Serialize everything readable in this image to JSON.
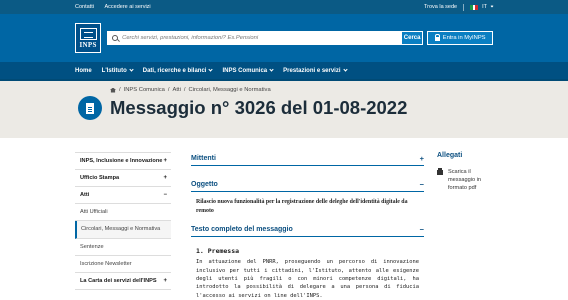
{
  "topbar": {
    "contatti": "Contatti",
    "accedere": "Accedere ai servizi",
    "trova_sede": "Trova la sede",
    "language": "IT"
  },
  "header": {
    "logo_text": "INPS",
    "search_placeholder": "Cerchi servizi, prestazioni, informazioni? Es.Pensioni",
    "search_button": "Cerca",
    "login_button": "Entra in MyINPS"
  },
  "nav": {
    "items": [
      {
        "label": "Home",
        "dropdown": false
      },
      {
        "label": "L'Istituto",
        "dropdown": true
      },
      {
        "label": "Dati, ricerche e bilanci",
        "dropdown": true
      },
      {
        "label": "INPS Comunica",
        "dropdown": true
      },
      {
        "label": "Prestazioni e servizi",
        "dropdown": true
      }
    ]
  },
  "breadcrumb": [
    "INPS Comunica",
    "Atti",
    "Circolari, Messaggi e Normativa"
  ],
  "page_title": "Messaggio n° 3026 del 01-08-2022",
  "sidebar": {
    "items": [
      {
        "label": "INPS, Inclusione e Innovazione",
        "toggle": "+"
      },
      {
        "label": "Ufficio Stampa",
        "toggle": "+"
      },
      {
        "label": "Atti",
        "toggle": "−"
      },
      {
        "label": "Atti Ufficiali"
      },
      {
        "label": "Circolari, Messaggi e Normativa"
      },
      {
        "label": "Sentenze"
      },
      {
        "label": "Iscrizione Newsletter"
      },
      {
        "label": "La Carta dei servizi dell'INPS",
        "toggle": "+"
      }
    ]
  },
  "main": {
    "mittenti": {
      "label": "Mittenti",
      "toggle": "+"
    },
    "oggetto": {
      "label": "Oggetto",
      "toggle": "−"
    },
    "oggetto_text": "Rilascio nuova funzionalità per la registrazione delle deleghe dell'identità digitale da remoto",
    "testo": {
      "label": "Testo completo del messaggio",
      "toggle": "−"
    },
    "premessa": "1. Premessa",
    "body": "In attuazione del PNRR, proseguendo un percorso di innovazione inclusivo per tutti i cittadini, l'Istituto, attento alle esigenze degli utenti più fragili o con minori competenze digitali, ha introdotto la possibilità di delegare a una persona di fiducia l'accesso ai servizi on line dell'INPS."
  },
  "allegati": {
    "title": "Allegati",
    "items": [
      {
        "label": "Scarica il messaggio in formato pdf",
        "icon": "printer-icon"
      }
    ]
  },
  "colors": {
    "topbar": "#0b5a85",
    "header": "#0066a4",
    "nav": "#005082",
    "title_band": "#eceae5",
    "accent": "#0b4f80"
  }
}
